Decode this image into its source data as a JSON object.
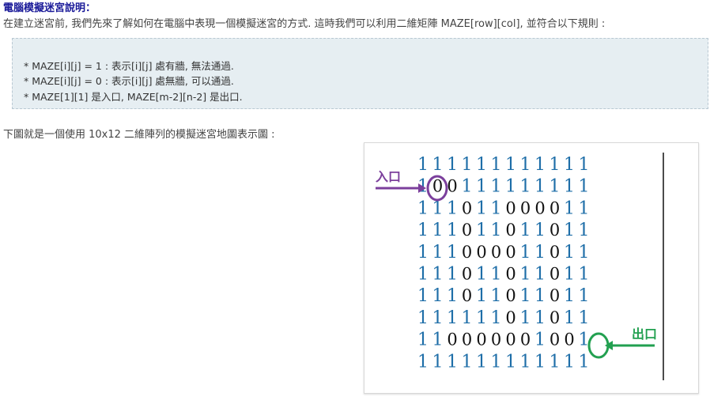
{
  "title": "電腦模擬迷宮說明：",
  "intro": "在建立迷宮前, 我們先來了解如何在電腦中表現一個模擬迷宮的方式. 這時我們可以利用二維矩陣 MAZE[row][col], 並符合以下規則 :",
  "rules": [
    "* MAZE[i][j] = 1 : 表示[i][j] 處有牆, 無法通過.",
    "* MAZE[i][j] = 0 : 表示[i][j] 處無牆, 可以通過.",
    "* MAZE[1][1] 是入口, MAZE[m-2][n-2] 是出口."
  ],
  "caption": "下圖就是一個使用 10x12 二維陣列的模擬迷宮地圖表示圖 :",
  "figure": {
    "entrance_label": "入口",
    "exit_label": "出口",
    "colors": {
      "wall": "#1e6ea8",
      "path": "#111111",
      "entrance": "#7b3f9c",
      "exit": "#22a050"
    },
    "maze": [
      "111111111111",
      "100111111111",
      "111011000011",
      "111011011011",
      "111000011011",
      "111011011011",
      "111011011011",
      "111111011011",
      "110000001001",
      "111111111111"
    ]
  }
}
